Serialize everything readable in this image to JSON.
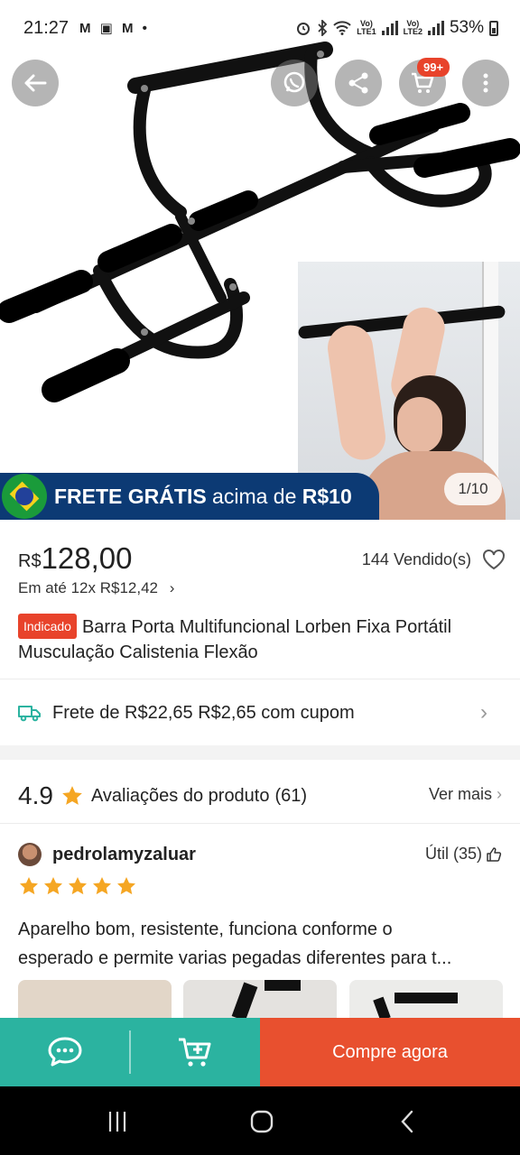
{
  "status_bar": {
    "time": "21:27",
    "left_icons": "M ▣ M •",
    "net1_top": "Vo)",
    "net1_bottom": "LTE1",
    "net2_top": "Vo)",
    "net2_bottom": "LTE2",
    "battery": "53%"
  },
  "gallery": {
    "counter": "1/10",
    "promo_bold": "FRETE GRÁTIS",
    "promo_light": " acima de ",
    "promo_amount": "R$10"
  },
  "top_buttons": {
    "cart_badge": "99+"
  },
  "product": {
    "currency": "R$",
    "price": "128,00",
    "sold": "144 Vendido(s)",
    "installment_prefix": "Em até ",
    "installment_value": "12x R$12,42",
    "installment_chevron": "›",
    "tag": "Indicado",
    "title": "Barra Porta Multifuncional Lorben Fixa Portátil Musculação Calistenia Flexão"
  },
  "shipping": {
    "text": "Frete de R$22,65 R$2,65 com cupom",
    "chevron": "›"
  },
  "reviews": {
    "rating": "4.9",
    "label": "Avaliações do produto",
    "count": "(61)",
    "see_more": "Ver mais",
    "see_more_chevron": "›",
    "star_color": "#f5a623",
    "item": {
      "author": "pedrolamyzaluar",
      "useful": "Útil (35)",
      "stars": 5,
      "text_line1": "Aparelho bom, resistente, funciona conforme o",
      "text_line2": "esperado e permite varias pegadas diferentes para t..."
    }
  },
  "actions": {
    "chat_icon": "chat-icon",
    "add_to_cart_icon": "cart-plus-icon",
    "buy_now": "Compre agora",
    "teal": "#2bb3a0",
    "orange": "#e8502f"
  }
}
